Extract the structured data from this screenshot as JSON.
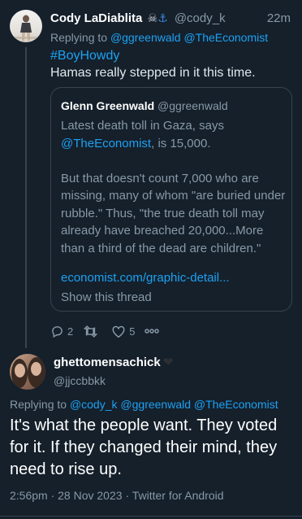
{
  "tweet1": {
    "display_name": "Cody LaDiablita",
    "name_emojis": "☠️⚓",
    "handle": "@cody_k",
    "time": "22m",
    "replying_prefix": "Replying to",
    "replying_to": [
      "@ggreenwald",
      "@TheEconomist"
    ],
    "hashtag": "#BoyHowdy",
    "text": "Hamas really stepped in it this time.",
    "quote": {
      "display_name": "Glenn Greenwald",
      "handle": "@ggreenwald",
      "line1_before": "Latest death toll in Gaza, says",
      "mention": "@TheEconomist",
      "line1_after": ", is 15,000.",
      "paragraph2": "But that doesn't count 7,000 who are missing, many of whom \"are buried under rubble.\" Thus, \"the true death toll may already have breached 20,000...More than a third of the dead are children.\"",
      "link": "economist.com/graphic-detail...",
      "show_thread": "Show this thread"
    },
    "actions": {
      "reply_count": "2",
      "retweet_count": "",
      "like_count": "5"
    }
  },
  "tweet2": {
    "display_name": "ghettomensachick",
    "name_badge": "🖤",
    "handle": "@jjccbbkk",
    "replying_prefix": "Replying to",
    "replying_to": [
      "@cody_k",
      "@ggreenwald",
      "@TheEconomist"
    ],
    "text": "It's what the people want.  They voted for it.  If they changed their mind, they need to rise up.",
    "timestamp": "2:56pm · 28 Nov 2023 · Twitter for Android"
  },
  "colors": {
    "background": "#15202b",
    "link": "#1da1f2",
    "muted": "#8899a6",
    "border": "#38444d"
  }
}
